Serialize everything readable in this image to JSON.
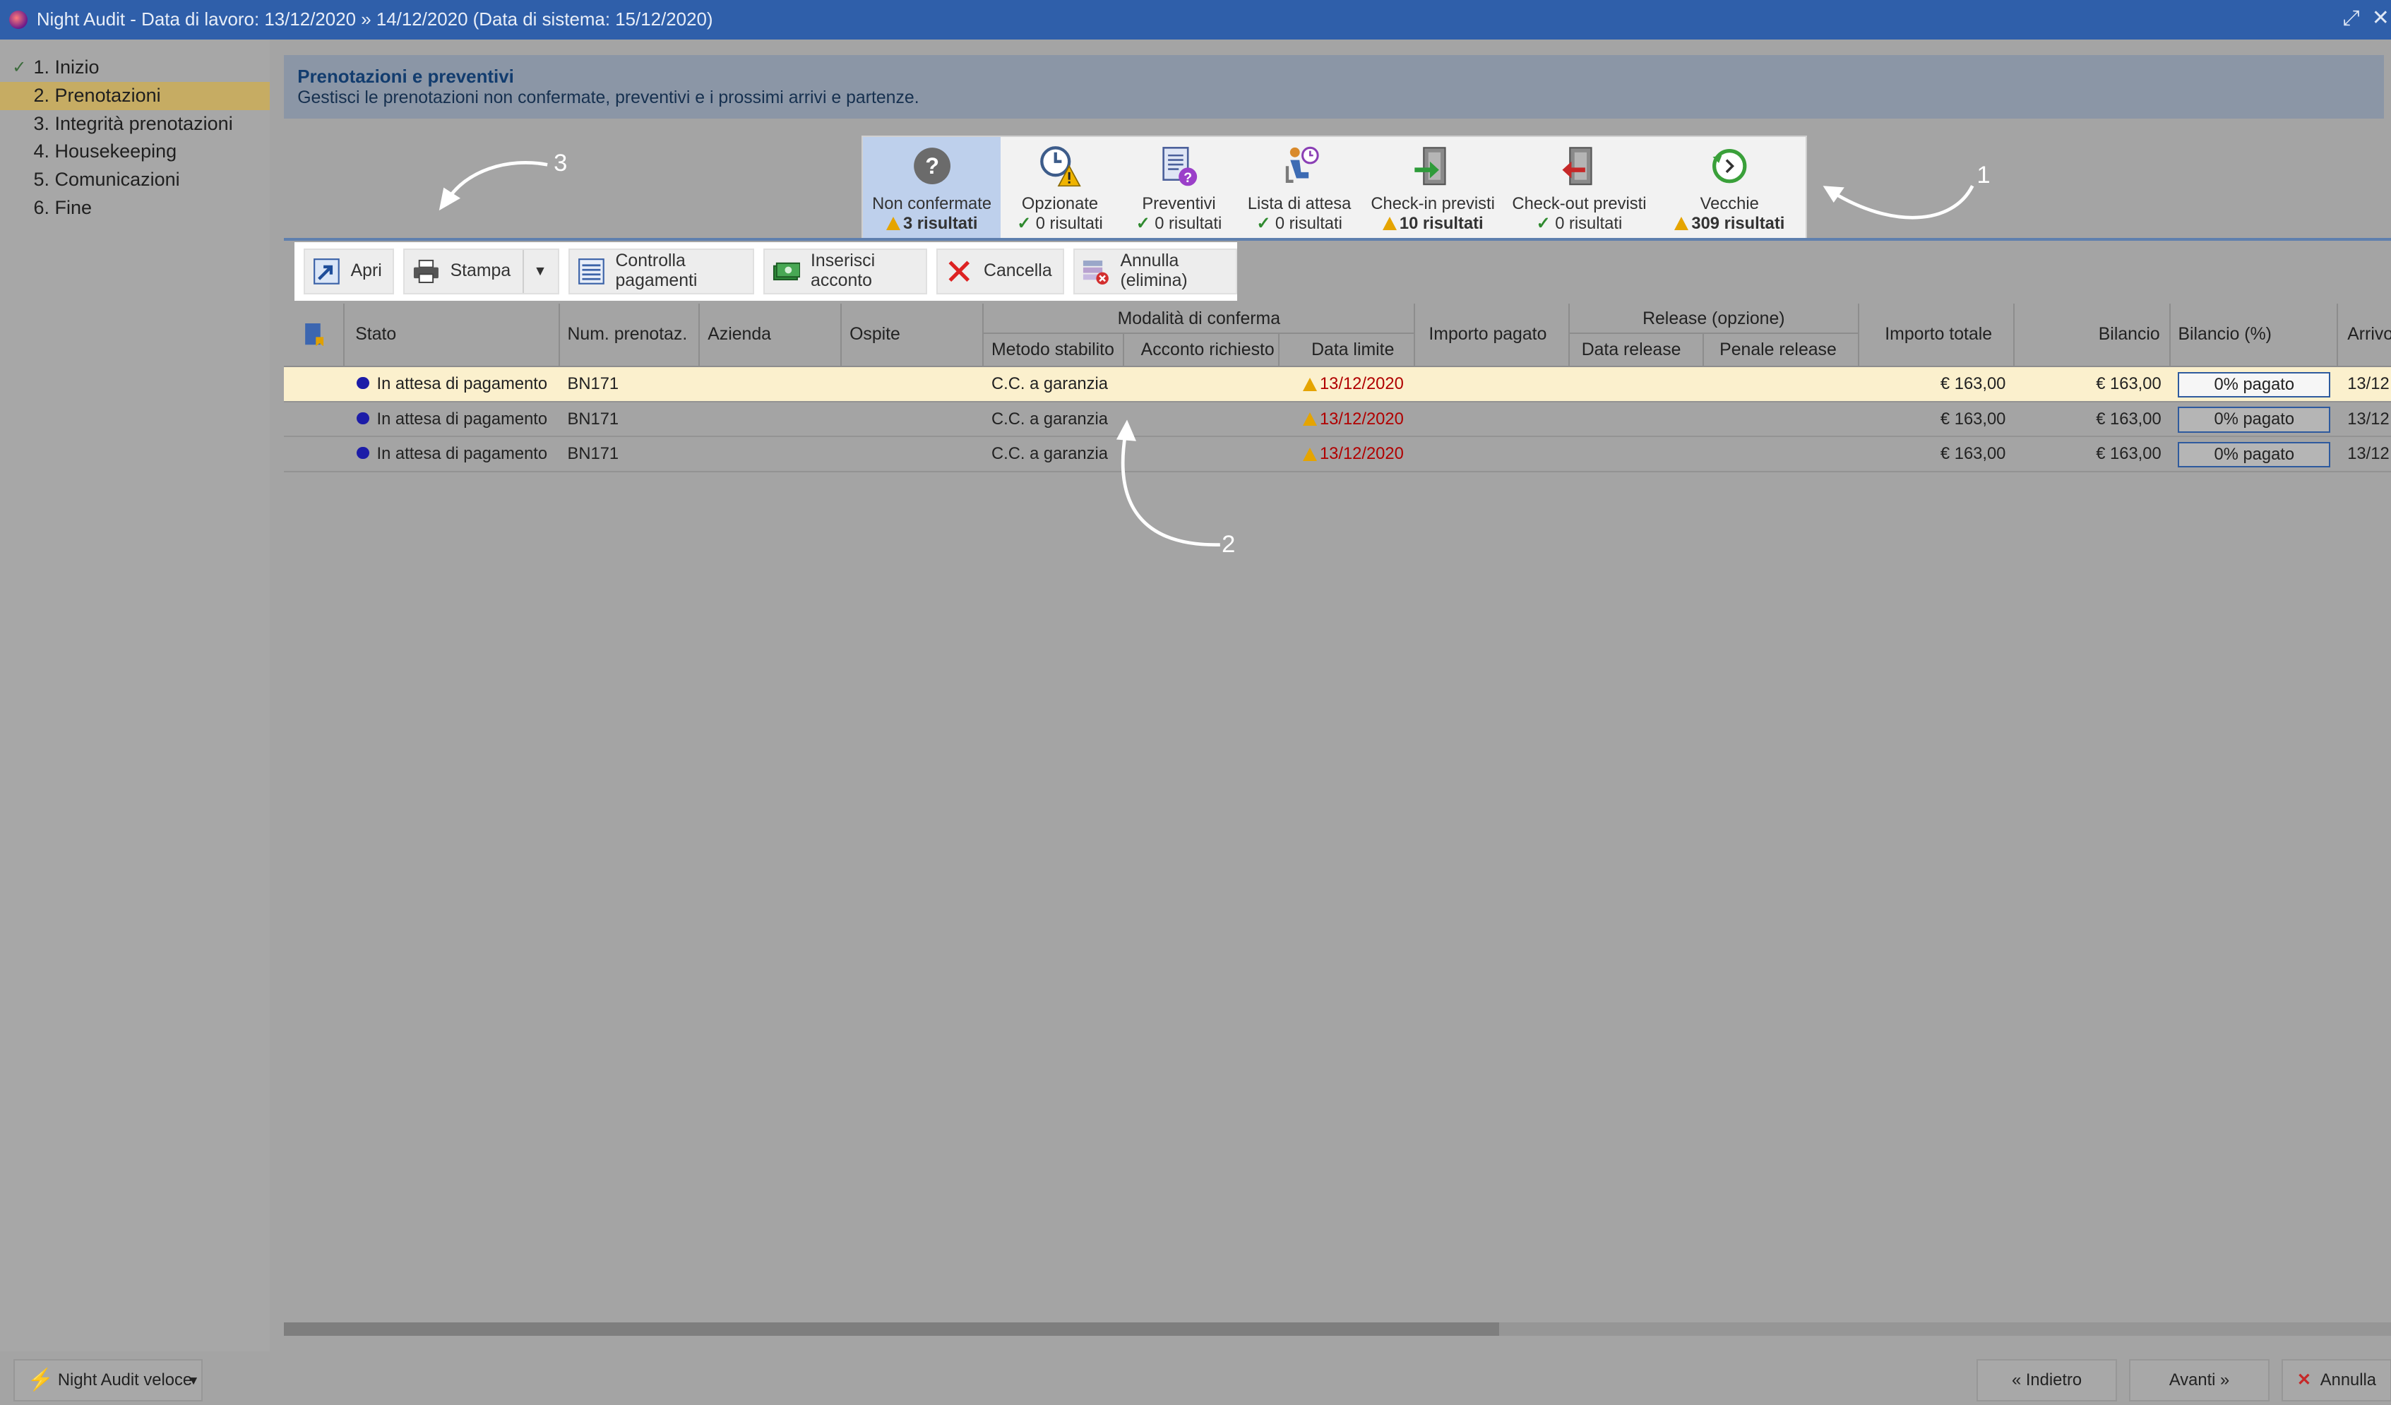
{
  "window": {
    "title": "Night Audit - Data di lavoro: 13/12/2020 » 14/12/2020 (Data di sistema: 15/12/2020)",
    "controls": [
      "maximize-icon",
      "close-icon"
    ]
  },
  "steps": [
    {
      "label": "1. Inizio",
      "done": true
    },
    {
      "label": "2. Prenotazioni",
      "active": true
    },
    {
      "label": "3. Integrità prenotazioni"
    },
    {
      "label": "4. Housekeeping"
    },
    {
      "label": "5. Comunicazioni"
    },
    {
      "label": "6. Fine"
    }
  ],
  "header": {
    "title": "Prenotazioni e preventivi",
    "subtitle": "Gestisci le prenotazioni non confermate, preventivi e i prossimi arrivi e partenze."
  },
  "tiles": [
    {
      "label": "Non confermate",
      "count": "3 risultati",
      "status": "warning",
      "icon": "question-icon",
      "selected": true
    },
    {
      "label": "Opzionate",
      "count": "0 risultati",
      "status": "ok",
      "icon": "clock-warning-icon"
    },
    {
      "label": "Preventivi",
      "count": "0 risultati",
      "status": "ok",
      "icon": "quote-document-icon"
    },
    {
      "label": "Lista di attesa",
      "count": "0 risultati",
      "status": "ok",
      "icon": "waiting-person-icon"
    },
    {
      "label": "Check-in previsti",
      "count": "10 risultati",
      "status": "warning",
      "icon": "checkin-door-icon"
    },
    {
      "label": "Check-out previsti",
      "count": "0 risultati",
      "status": "ok",
      "icon": "checkout-door-icon"
    },
    {
      "label": "Vecchie",
      "count": "309 risultati",
      "status": "warning",
      "icon": "history-icon"
    }
  ],
  "toolbar": {
    "open": "Apri",
    "print": "Stampa",
    "check_payments": "Controlla pagamenti",
    "add_deposit": "Inserisci acconto",
    "delete": "Cancella",
    "cancel_delete": "Annulla (elimina)"
  },
  "columns": {
    "stato": "Stato",
    "num": "Num. prenotaz.",
    "azienda": "Azienda",
    "ospite": "Ospite",
    "modalita": "Modalità di conferma",
    "metodo": "Metodo stabilito",
    "acconto": "Acconto richiesto",
    "data_limite": "Data limite",
    "importo_pagato": "Importo pagato",
    "release": "Release (opzione)",
    "data_release": "Data release",
    "penale_release": "Penale release",
    "importo_totale": "Importo totale",
    "bilancio": "Bilancio",
    "bilancio_pct": "Bilancio (%)",
    "arrivo": "Arrivo"
  },
  "rows": [
    {
      "stato": "In attesa di pagamento",
      "num": "BN171",
      "azienda": "",
      "ospite": "",
      "metodo": "C.C. a garanzia",
      "acconto": "",
      "data_limite": "13/12/2020",
      "importo_pagato": "",
      "data_release": "",
      "penale_release": "",
      "importo_totale": "€ 163,00",
      "bilancio": "€ 163,00",
      "bilancio_pct": "0% pagato",
      "arrivo": "13/12"
    },
    {
      "stato": "In attesa di pagamento",
      "num": "BN171",
      "azienda": "",
      "ospite": "",
      "metodo": "C.C. a garanzia",
      "acconto": "",
      "data_limite": "13/12/2020",
      "importo_pagato": "",
      "data_release": "",
      "penale_release": "",
      "importo_totale": "€ 163,00",
      "bilancio": "€ 163,00",
      "bilancio_pct": "0% pagato",
      "arrivo": "13/12"
    },
    {
      "stato": "In attesa di pagamento",
      "num": "BN171",
      "azienda": "",
      "ospite": "",
      "metodo": "C.C. a garanzia",
      "acconto": "",
      "data_limite": "13/12/2020",
      "importo_pagato": "",
      "data_release": "",
      "penale_release": "",
      "importo_totale": "€ 163,00",
      "bilancio": "€ 163,00",
      "bilancio_pct": "0% pagato",
      "arrivo": "13/12"
    }
  ],
  "footer": {
    "quick": "Night Audit veloce",
    "back": "« Indietro",
    "next": "Avanti »",
    "cancel": "Annulla"
  },
  "annotations": {
    "a1": "1",
    "a2": "2",
    "a3": "3"
  },
  "colors": {
    "titlebar": "#2f5faa",
    "active_step": "#c6ac63",
    "selected_tile": "#bed0ec",
    "highlight_row": "#fbf0cd",
    "warning_date": "#b00000"
  }
}
